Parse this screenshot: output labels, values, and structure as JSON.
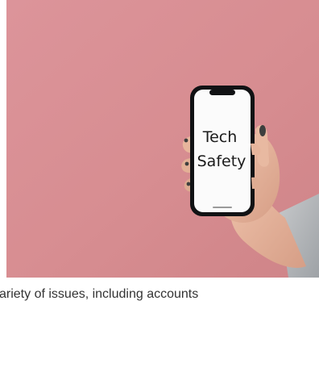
{
  "hero_image": {
    "phone_text_line1": "Tech",
    "phone_text_line2": "Safety",
    "background_color": "#d98f93"
  },
  "caption": {
    "text": "variety of issues, including accounts"
  }
}
